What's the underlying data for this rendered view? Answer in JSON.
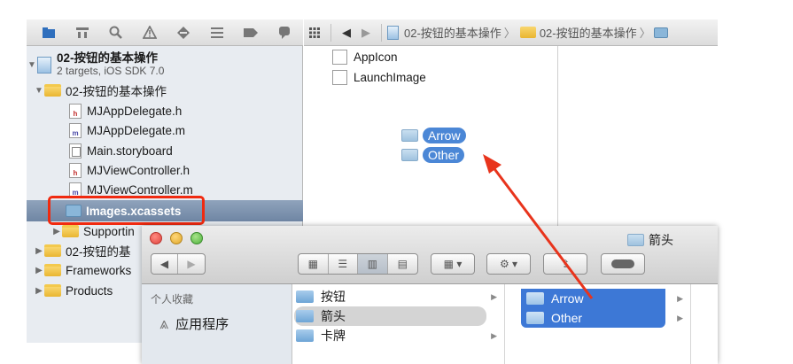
{
  "navigator": {
    "project": {
      "name": "02-按钮的基本操作",
      "subtitle": "2 targets, iOS SDK 7.0"
    },
    "items": [
      {
        "label": "02-按钮的基本操作",
        "type": "group"
      },
      {
        "label": "MJAppDelegate.h",
        "type": "header",
        "badge": "h"
      },
      {
        "label": "MJAppDelegate.m",
        "type": "impl",
        "badge": "m"
      },
      {
        "label": "Main.storyboard",
        "type": "storyboard"
      },
      {
        "label": "MJViewController.h",
        "type": "header",
        "badge": "h"
      },
      {
        "label": "MJViewController.m",
        "type": "impl",
        "badge": "m"
      },
      {
        "label": "Images.xcassets",
        "type": "xcassets",
        "selected": true
      },
      {
        "label": "Supportin",
        "type": "group"
      },
      {
        "label": "02-按钮的基",
        "type": "group"
      },
      {
        "label": "Frameworks",
        "type": "group"
      },
      {
        "label": "Products",
        "type": "group"
      }
    ]
  },
  "breadcrumb": {
    "items": [
      "02-按钮的基本操作",
      "02-按钮的基本操作"
    ],
    "separator": "〉"
  },
  "assets": {
    "items": [
      "AppIcon",
      "LaunchImage"
    ],
    "groups": [
      "Arrow",
      "Other"
    ]
  },
  "finder": {
    "title": "箭头",
    "sidebar": {
      "section": "个人收藏",
      "item": "应用程序"
    },
    "column1": [
      "按钮",
      "箭头",
      "卡牌"
    ],
    "column2": [
      "Arrow",
      "Other"
    ]
  },
  "colors": {
    "selection": "#4b87d6",
    "highlight": "#f02a10",
    "arrow": "#e8341c"
  }
}
